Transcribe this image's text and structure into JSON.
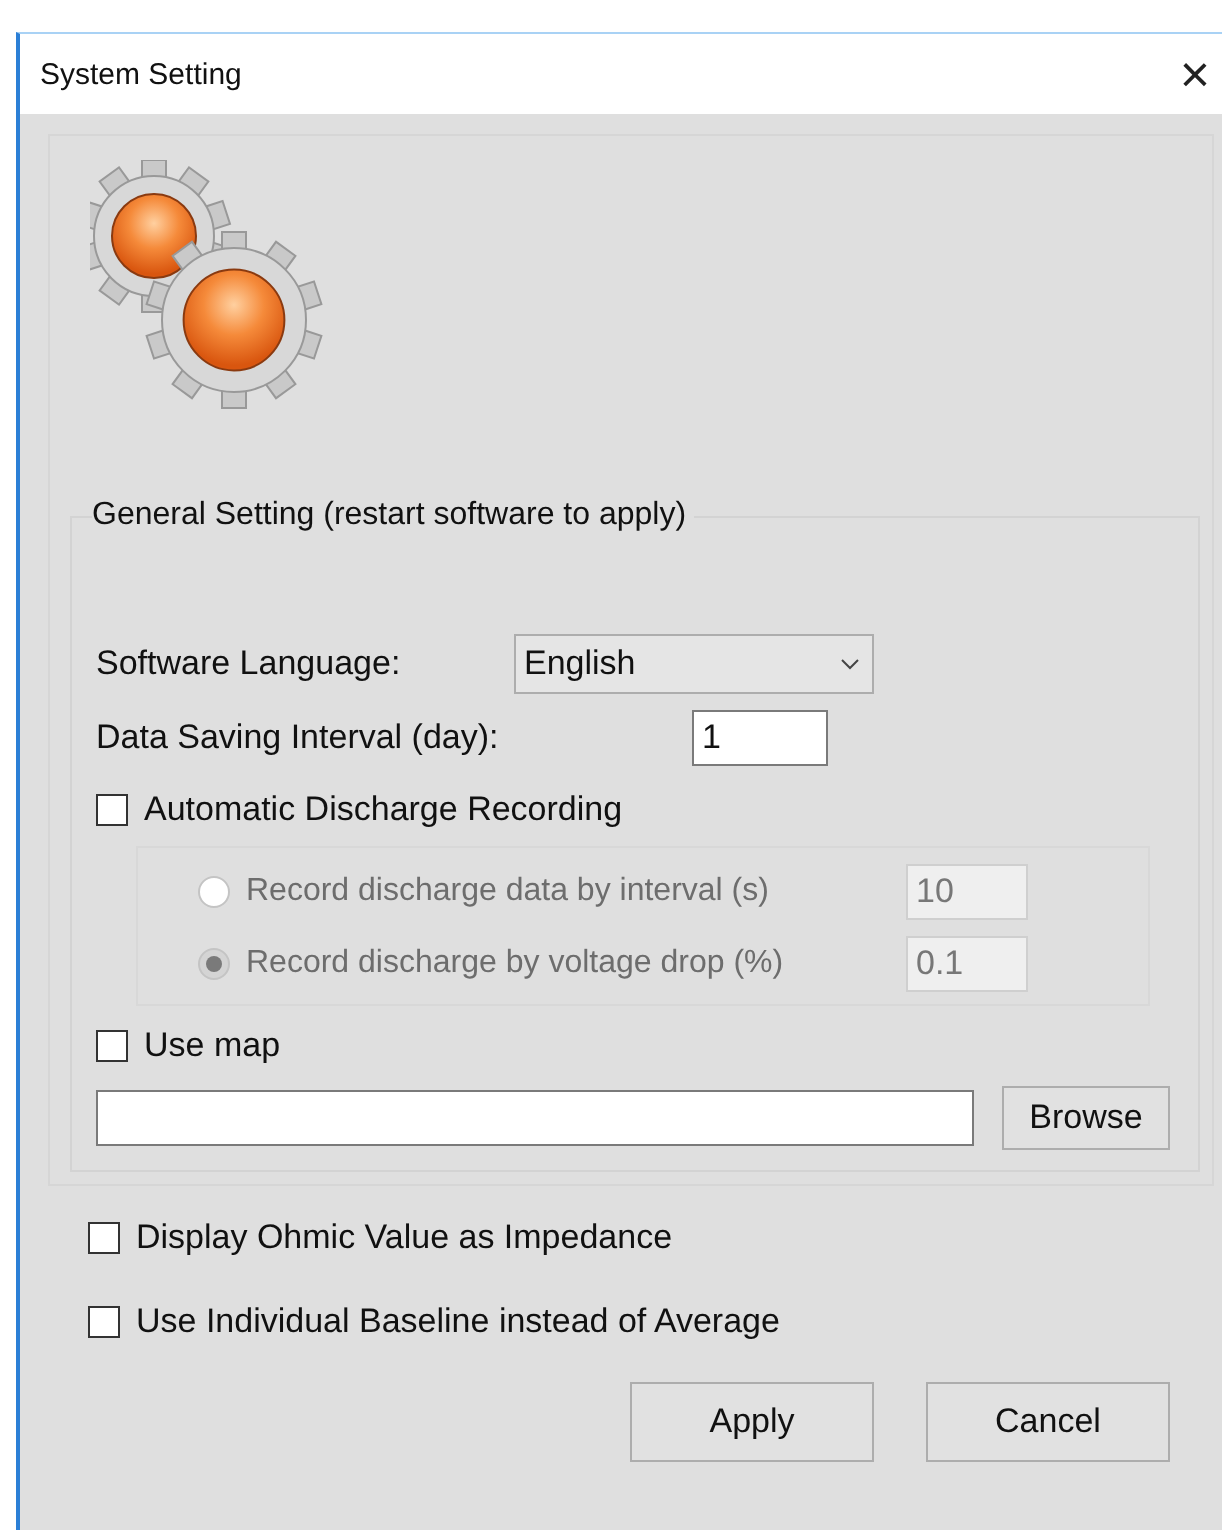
{
  "window": {
    "title": "System Setting",
    "close": "×"
  },
  "general": {
    "title": "General Setting (restart software to apply)",
    "language": {
      "label": "Software Language:",
      "value": "English"
    },
    "interval": {
      "label": "Data Saving Interval (day):",
      "value": "1"
    },
    "auto_discharge": {
      "label": "Automatic Discharge Recording",
      "checked": false
    },
    "discharge_options": [
      {
        "label": "Record discharge data by interval (s)",
        "value": "10",
        "selected": false,
        "disabled": true
      },
      {
        "label": "Record discharge by voltage drop (%)",
        "value": "0.1",
        "selected": true,
        "disabled": true
      }
    ],
    "use_map": {
      "label": "Use map",
      "checked": false
    },
    "browse": "Browse"
  },
  "options": [
    {
      "label": "Display Ohmic Value as Impedance",
      "checked": false
    },
    {
      "label": "Use Individual Baseline instead of Average",
      "checked": false
    }
  ],
  "buttons": [
    "Apply",
    "Cancel"
  ]
}
